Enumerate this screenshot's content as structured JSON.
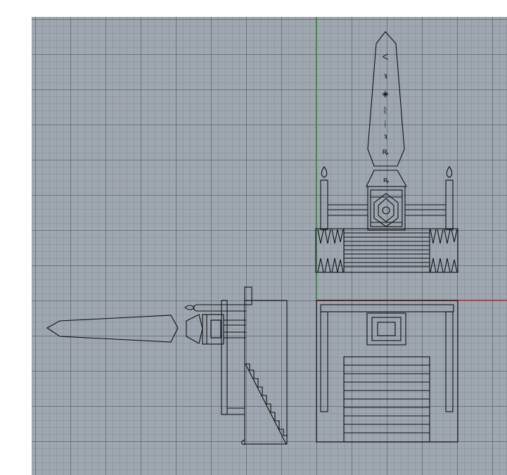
{
  "viewport": {
    "view": "top",
    "background_color": "#9ea6af",
    "grid_color": "#5a6270",
    "axis_x_color": "#c0392b",
    "axis_y_color": "#2e9a2e",
    "model_line_color": "#111111"
  },
  "obelisk": {
    "glyphs": [
      "ᐸ",
      "ꝛ",
      "◈",
      "ᚱ",
      "ᚿ",
      "ꝛ",
      "ꝶ"
    ]
  }
}
